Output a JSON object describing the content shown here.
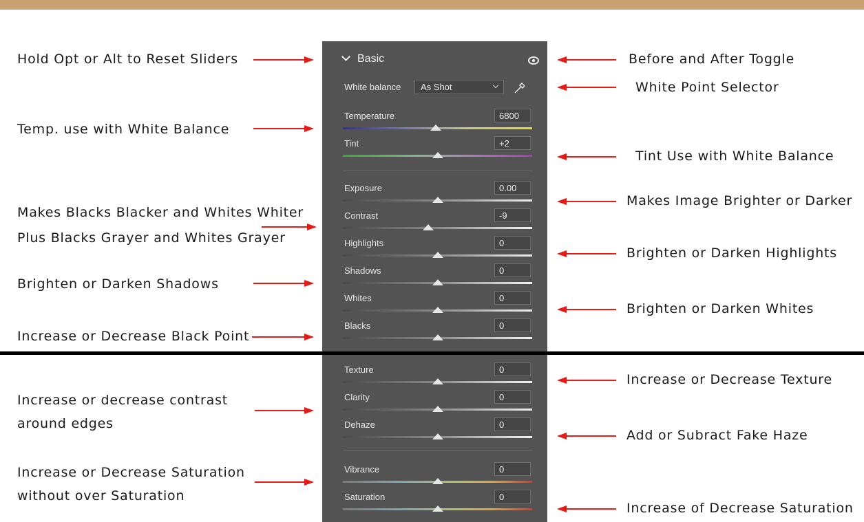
{
  "panel": {
    "title": "Basic",
    "white_balance_label": "White balance",
    "white_balance_value": "As Shot",
    "sliders": [
      {
        "label": "Temperature",
        "value": "6800",
        "position": 0.49,
        "track": "temperature"
      },
      {
        "label": "Tint",
        "value": "+2",
        "position": 0.5,
        "track": "tint"
      },
      {
        "label": "Exposure",
        "value": "0.00",
        "position": 0.5,
        "track": "gray"
      },
      {
        "label": "Contrast",
        "value": "-9",
        "position": 0.45,
        "track": "gray"
      },
      {
        "label": "Highlights",
        "value": "0",
        "position": 0.5,
        "track": "gray"
      },
      {
        "label": "Shadows",
        "value": "0",
        "position": 0.5,
        "track": "gray"
      },
      {
        "label": "Whites",
        "value": "0",
        "position": 0.5,
        "track": "gray"
      },
      {
        "label": "Blacks",
        "value": "0",
        "position": 0.5,
        "track": "gray"
      },
      {
        "label": "Texture",
        "value": "0",
        "position": 0.5,
        "track": "gray"
      },
      {
        "label": "Clarity",
        "value": "0",
        "position": 0.5,
        "track": "gray"
      },
      {
        "label": "Dehaze",
        "value": "0",
        "position": 0.5,
        "track": "gray"
      },
      {
        "label": "Vibrance",
        "value": "0",
        "position": 0.5,
        "track": "saturation"
      },
      {
        "label": "Saturation",
        "value": "0",
        "position": 0.5,
        "track": "saturation"
      }
    ]
  },
  "annotations_left": [
    "Hold Opt or Alt to Reset Sliders",
    "Temp. use with White Balance",
    "Makes Blacks Blacker and Whites Whiter",
    "Plus Blacks Grayer and Whites Grayer",
    "Brighten or Darken Shadows",
    "Increase or Decrease Black Point",
    "Increase or decrease contrast",
    "around edges",
    "Increase or Decrease Saturation",
    "without over Saturation"
  ],
  "annotations_right": [
    "Before and After Toggle",
    "White Point Selector",
    "Tint Use with White Balance",
    "Makes Image Brighter or Darker",
    "Brighten or Darken Highlights",
    "Brighten or Darken Whites",
    "Increase or Decrease Texture",
    "Add or Subract Fake Haze",
    "Increase of Decrease Saturation"
  ],
  "colors": {
    "top_bar": "#c8a272",
    "panel_bg": "#535353",
    "arrow": "#e41b17"
  }
}
